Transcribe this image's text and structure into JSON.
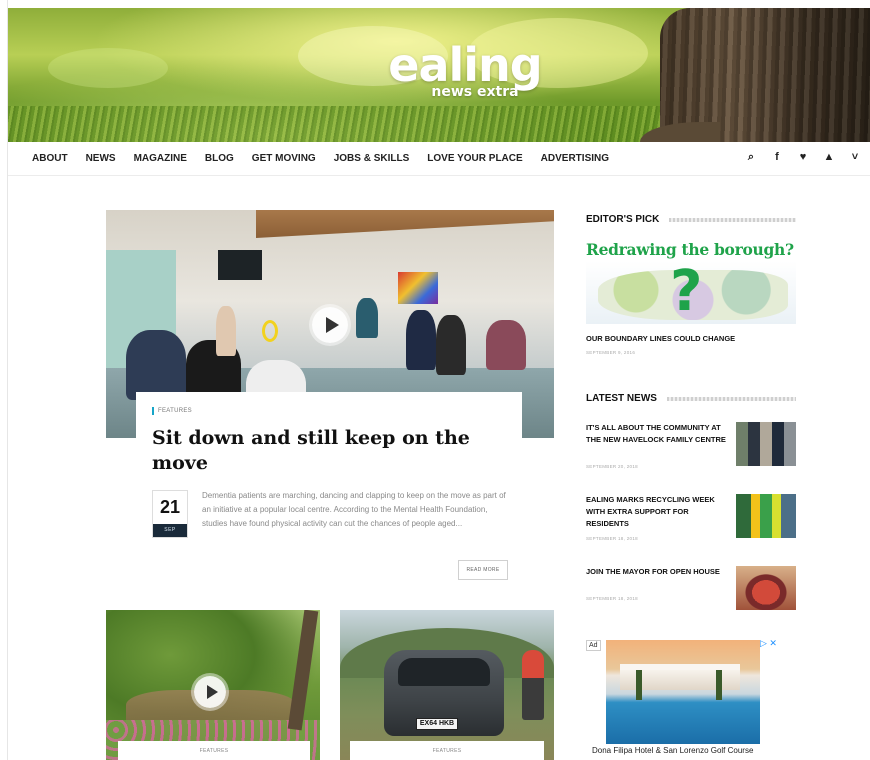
{
  "header": {
    "logo_main": "ealing",
    "logo_sub": "news extra"
  },
  "nav": {
    "items": [
      "ABOUT",
      "NEWS",
      "MAGAZINE",
      "BLOG",
      "GET MOVING",
      "JOBS & SKILLS",
      "LOVE YOUR PLACE",
      "ADVERTISING"
    ],
    "icons": [
      {
        "name": "search-icon",
        "glyph": "🔍︎"
      },
      {
        "name": "facebook-icon",
        "glyph": "f"
      },
      {
        "name": "twitter-icon",
        "glyph": "♥︎"
      },
      {
        "name": "youtube-icon",
        "glyph": "▲"
      },
      {
        "name": "more-chevron-icon",
        "glyph": "˅"
      }
    ]
  },
  "feature": {
    "category": "FEATURES",
    "title": "Sit down and still keep on the move",
    "date_day": "21",
    "date_month": "SEP",
    "excerpt": "Dementia patients are marching, dancing and clapping to keep on the move as part of an initiative at a popular local centre. According to the Mental Health Foundation, studies have found physical activity can cut the chances of people aged...",
    "read_more": "READ MORE"
  },
  "cards": [
    {
      "category": "FEATURES"
    },
    {
      "category": "FEATURES",
      "plate": "EX64 HKB"
    }
  ],
  "sidebar": {
    "editors_pick_heading": "EDITOR'S PICK",
    "editors_pick": {
      "image_title": "Redrawing the borough?",
      "image_glyph": "?",
      "caption": "OUR BOUNDARY LINES COULD CHANGE",
      "date": "SEPTEMBER 9, 2016"
    },
    "latest_news_heading": "LATEST NEWS",
    "latest_news": [
      {
        "title": "IT'S ALL ABOUT THE COMMUNITY AT THE NEW HAVELOCK FAMILY CENTRE",
        "date": "SEPTEMBER 20, 2018"
      },
      {
        "title": "EALING MARKS RECYCLING WEEK WITH EXTRA SUPPORT FOR RESIDENTS",
        "date": "SEPTEMBER 18, 2018"
      },
      {
        "title": "JOIN THE MAYOR FOR OPEN HOUSE",
        "date": "SEPTEMBER 18, 2018"
      }
    ],
    "ad": {
      "label": "Ad",
      "controls": "▷ ✕",
      "caption": "Dona Filipa Hotel & San Lorenzo Golf Course"
    }
  }
}
